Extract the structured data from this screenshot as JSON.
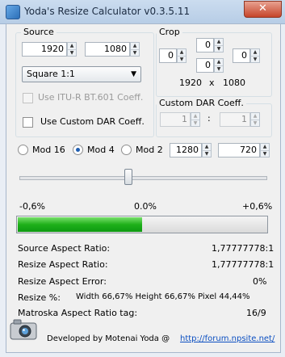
{
  "window": {
    "title": "Yoda's Resize Calculator  v0.3.5.11",
    "close_glyph": "✕"
  },
  "source": {
    "label": "Source",
    "width": "1920",
    "height": "1080",
    "ratio_selected": "Square 1:1",
    "itu_label": "Use ITU-R BT.601 Coeff.",
    "custom_dar_label": "Use Custom DAR Coeff."
  },
  "crop": {
    "label": "Crop",
    "top": "0",
    "left": "0",
    "bottom": "0",
    "right": "0",
    "result_width": "1920",
    "result_x": "x",
    "result_height": "1080"
  },
  "custom_dar": {
    "label": "Custom DAR Coeff.",
    "value1": "1",
    "separator": ":",
    "value2": "1"
  },
  "mod": {
    "mod16": "Mod 16",
    "mod4": "Mod 4",
    "mod2": "Mod 2",
    "selected": "Mod 4",
    "width": "1280",
    "height": "720"
  },
  "error_scale": {
    "min": "-0,6%",
    "mid": "0.0%",
    "max": "+0,6%",
    "fill_fraction": 0.5
  },
  "stats": {
    "source_ar_label": "Source Aspect Ratio:",
    "source_ar_value": "1,77777778:1",
    "resize_ar_label": "Resize Aspect Ratio:",
    "resize_ar_value": "1,77777778:1",
    "resize_err_label": "Resize Aspect Error:",
    "resize_err_value": "0%",
    "resize_pct_label": "Resize %:",
    "resize_pct_value": "Width 66,67%  Height 66,67%  Pixel 44,44%",
    "mkv_label": "Matroska Aspect Ratio tag:",
    "mkv_value": "16/9"
  },
  "footer": {
    "dev_text": "Developed by Motenai Yoda @",
    "link_text": "http://forum.npsite.net/"
  },
  "icons": {
    "app": "app-icon",
    "camera": "camera-icon",
    "spin": "spinner-arrows"
  }
}
